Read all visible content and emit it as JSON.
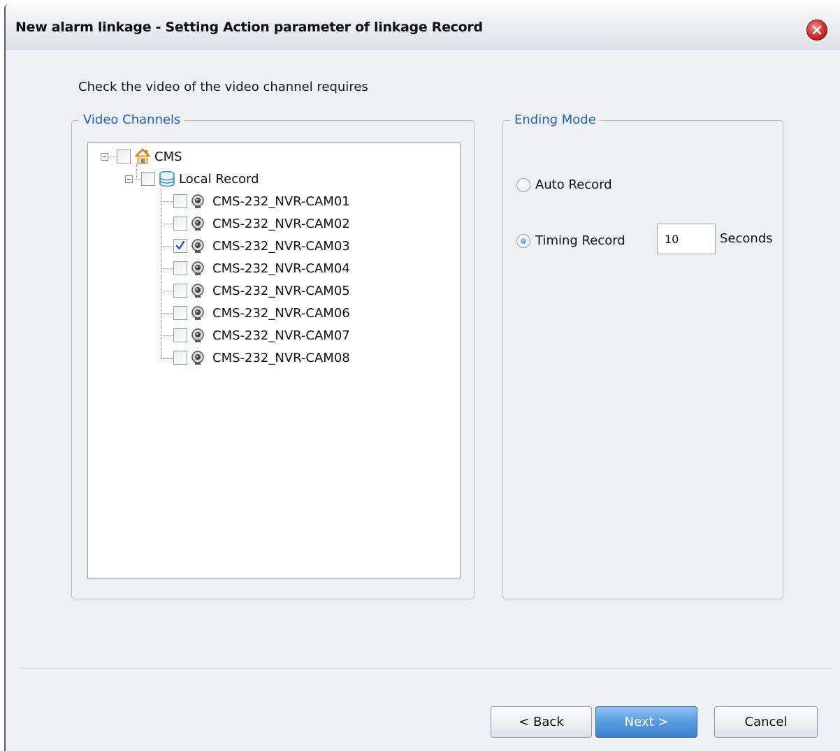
{
  "window": {
    "title": "New alarm linkage  -  Setting Action parameter of linkage Record"
  },
  "instruction": "Check the video of the video channel requires",
  "video_channels": {
    "legend": "Video Channels",
    "root": {
      "label": "CMS",
      "checked": false
    },
    "group": {
      "label": "Local Record",
      "checked": false
    },
    "cameras": [
      {
        "label": "CMS-232_NVR-CAM01",
        "checked": false
      },
      {
        "label": "CMS-232_NVR-CAM02",
        "checked": false
      },
      {
        "label": "CMS-232_NVR-CAM03",
        "checked": true
      },
      {
        "label": "CMS-232_NVR-CAM04",
        "checked": false
      },
      {
        "label": "CMS-232_NVR-CAM05",
        "checked": false
      },
      {
        "label": "CMS-232_NVR-CAM06",
        "checked": false
      },
      {
        "label": "CMS-232_NVR-CAM07",
        "checked": false
      },
      {
        "label": "CMS-232_NVR-CAM08",
        "checked": false
      }
    ]
  },
  "ending_mode": {
    "legend": "Ending Mode",
    "auto_record_label": "Auto Record",
    "timing_record_label": "Timing Record",
    "selected": "timing",
    "seconds_value": "10",
    "seconds_label": "Seconds"
  },
  "buttons": {
    "back": "< Back",
    "next": "Next >",
    "cancel": "Cancel"
  },
  "colors": {
    "legend_text": "#1f5fb8",
    "next_button": "#5b9ee0",
    "close_button": "#d22a2a"
  }
}
